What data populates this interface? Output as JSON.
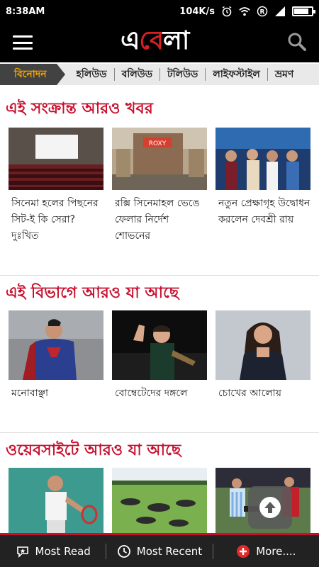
{
  "status_bar": {
    "time": "8:38AM",
    "speed": "104K/s",
    "icons": [
      "alarm-icon",
      "wifi-icon",
      "registered-icon",
      "signal-icon",
      "battery-icon"
    ],
    "battery_level": 0.85
  },
  "app_bar": {
    "logo_left": "এ",
    "logo_mid": "বে",
    "logo_right": "লা",
    "menu_icon": "hamburger-icon",
    "search_icon": "search-icon"
  },
  "tabs": [
    {
      "label": "বিনোদন",
      "active": true
    },
    {
      "label": "হলিউড"
    },
    {
      "label": "বলিউড"
    },
    {
      "label": "টলিউড"
    },
    {
      "label": "লাইফস্টাইল"
    },
    {
      "label": "ভ্রমণ"
    }
  ],
  "sections": [
    {
      "title": "এই সংক্রান্ত আরও খবর",
      "items": [
        {
          "title": "সিনেমা হলের পিছনের সিট-ই কি সেরা? দুঃখিত"
        },
        {
          "title": "রক্সি সিনেমাহল ভেঙে ফেলার নির্দেশ শোভনের"
        },
        {
          "title": "নতুন প্রেক্ষাগৃহ উদ্বোধন করলেন দেবশ্রী রায়"
        }
      ]
    },
    {
      "title": "এই বিভাগে আরও যা আছে",
      "items": [
        {
          "title": "মনোবাঞ্ছা"
        },
        {
          "title": "বোম্বেটেদের দঙ্গলে"
        },
        {
          "title": "চোখের আলোয়"
        }
      ]
    },
    {
      "title": "ওয়েবসাইটে আরও যা আছে",
      "items": [
        {
          "title": ""
        },
        {
          "title": ""
        },
        {
          "title": ""
        }
      ]
    }
  ],
  "bottom_bar": {
    "most_read": "Most Read",
    "most_recent": "Most Recent",
    "more": "More...."
  },
  "colors": {
    "accent_red": "#c8102e",
    "tab_active_text": "#f6a800",
    "bar_black": "#000000"
  }
}
